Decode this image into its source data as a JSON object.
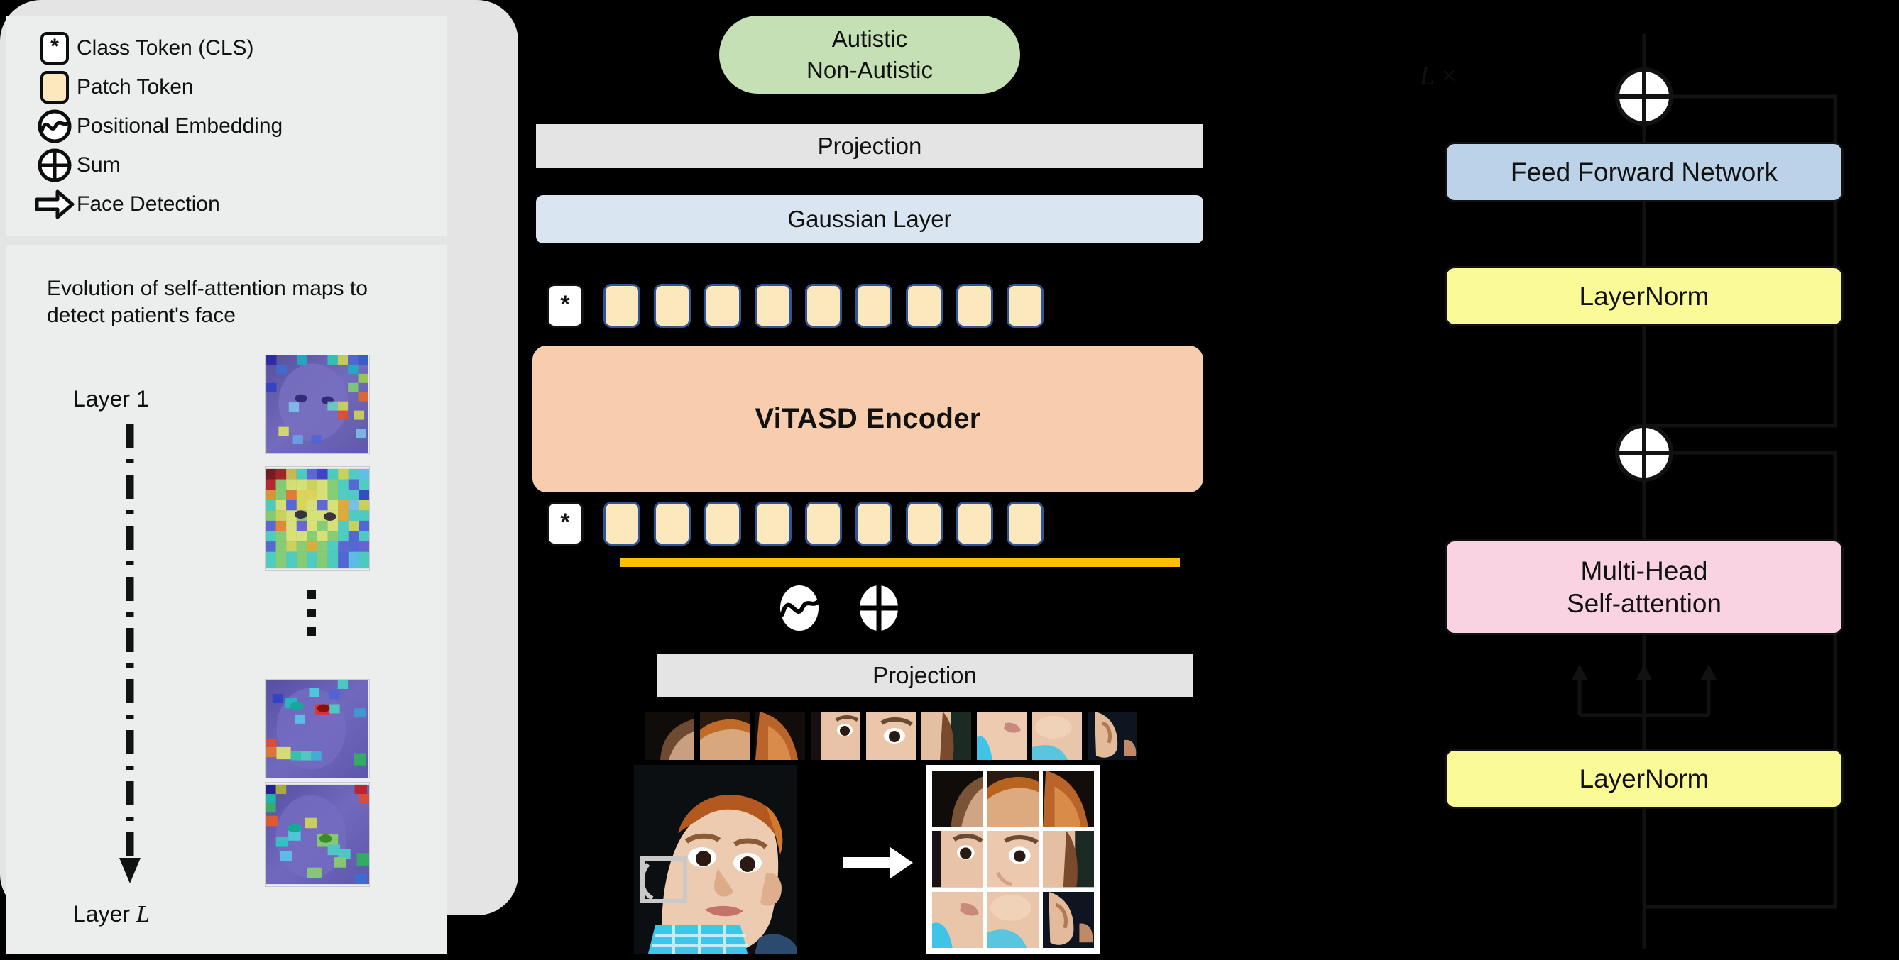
{
  "legend": {
    "items": [
      {
        "icon": "cls-token-icon",
        "glyph": "*",
        "label": "Class Token (CLS)"
      },
      {
        "icon": "patch-token-icon",
        "glyph": "",
        "label": "Patch Token"
      },
      {
        "icon": "positional-embedding-icon",
        "glyph": "",
        "label": "Positional Embedding"
      },
      {
        "icon": "sum-icon",
        "glyph": "",
        "label": "Sum"
      },
      {
        "icon": "face-detection-arrow-icon",
        "glyph": "",
        "label": "Face Detection"
      }
    ]
  },
  "attention": {
    "title": "Evolution of self-attention maps to detect patient's face",
    "layer_first": "Layer 1",
    "layer_last_prefix": "Layer ",
    "layer_last_symbol": "L",
    "map_count": 4,
    "ellipsis": "vertical-dots"
  },
  "center": {
    "output_label": "Autistic\nNon-Autistic",
    "output_line1": "Autistic",
    "output_line2": "Non-Autistic",
    "projection_top": "Projection",
    "gaussian_layer": "Gaussian Layer",
    "encoder": "ViTASD Encoder",
    "projection_bottom": "Projection",
    "cls_glyph": "*",
    "patch_token_count": 9,
    "face_patch_count": 9,
    "grid_rows": 3,
    "grid_cols": 3
  },
  "right": {
    "repeat_label_symbol": "L",
    "repeat_label_times": "×",
    "feed_forward": "Feed Forward Network",
    "layernorm_top": "LayerNorm",
    "multi_head": "Multi-Head\nSelf-attention",
    "multi_head_line1": "Multi-Head",
    "multi_head_line2": "Self-attention",
    "layernorm_bottom": "LayerNorm",
    "sum_nodes": 2,
    "qkv_arrows": 3
  },
  "colors": {
    "background": "#000000",
    "panel": "#eceded",
    "right_panel": "#e4e4e4",
    "output_pill": "#c5e0b4",
    "projection": "#e4e4e4",
    "gaussian": "#dae5f2",
    "encoder": "#f8cdae",
    "patch_token_fill": "#fce8bd",
    "patch_token_border": "#2f5597",
    "highlight_line": "#ffc000",
    "feed_forward": "#bcd2e8",
    "layernorm": "#fafa96",
    "multi_head": "#fad3e3",
    "stroke": "#121212"
  }
}
